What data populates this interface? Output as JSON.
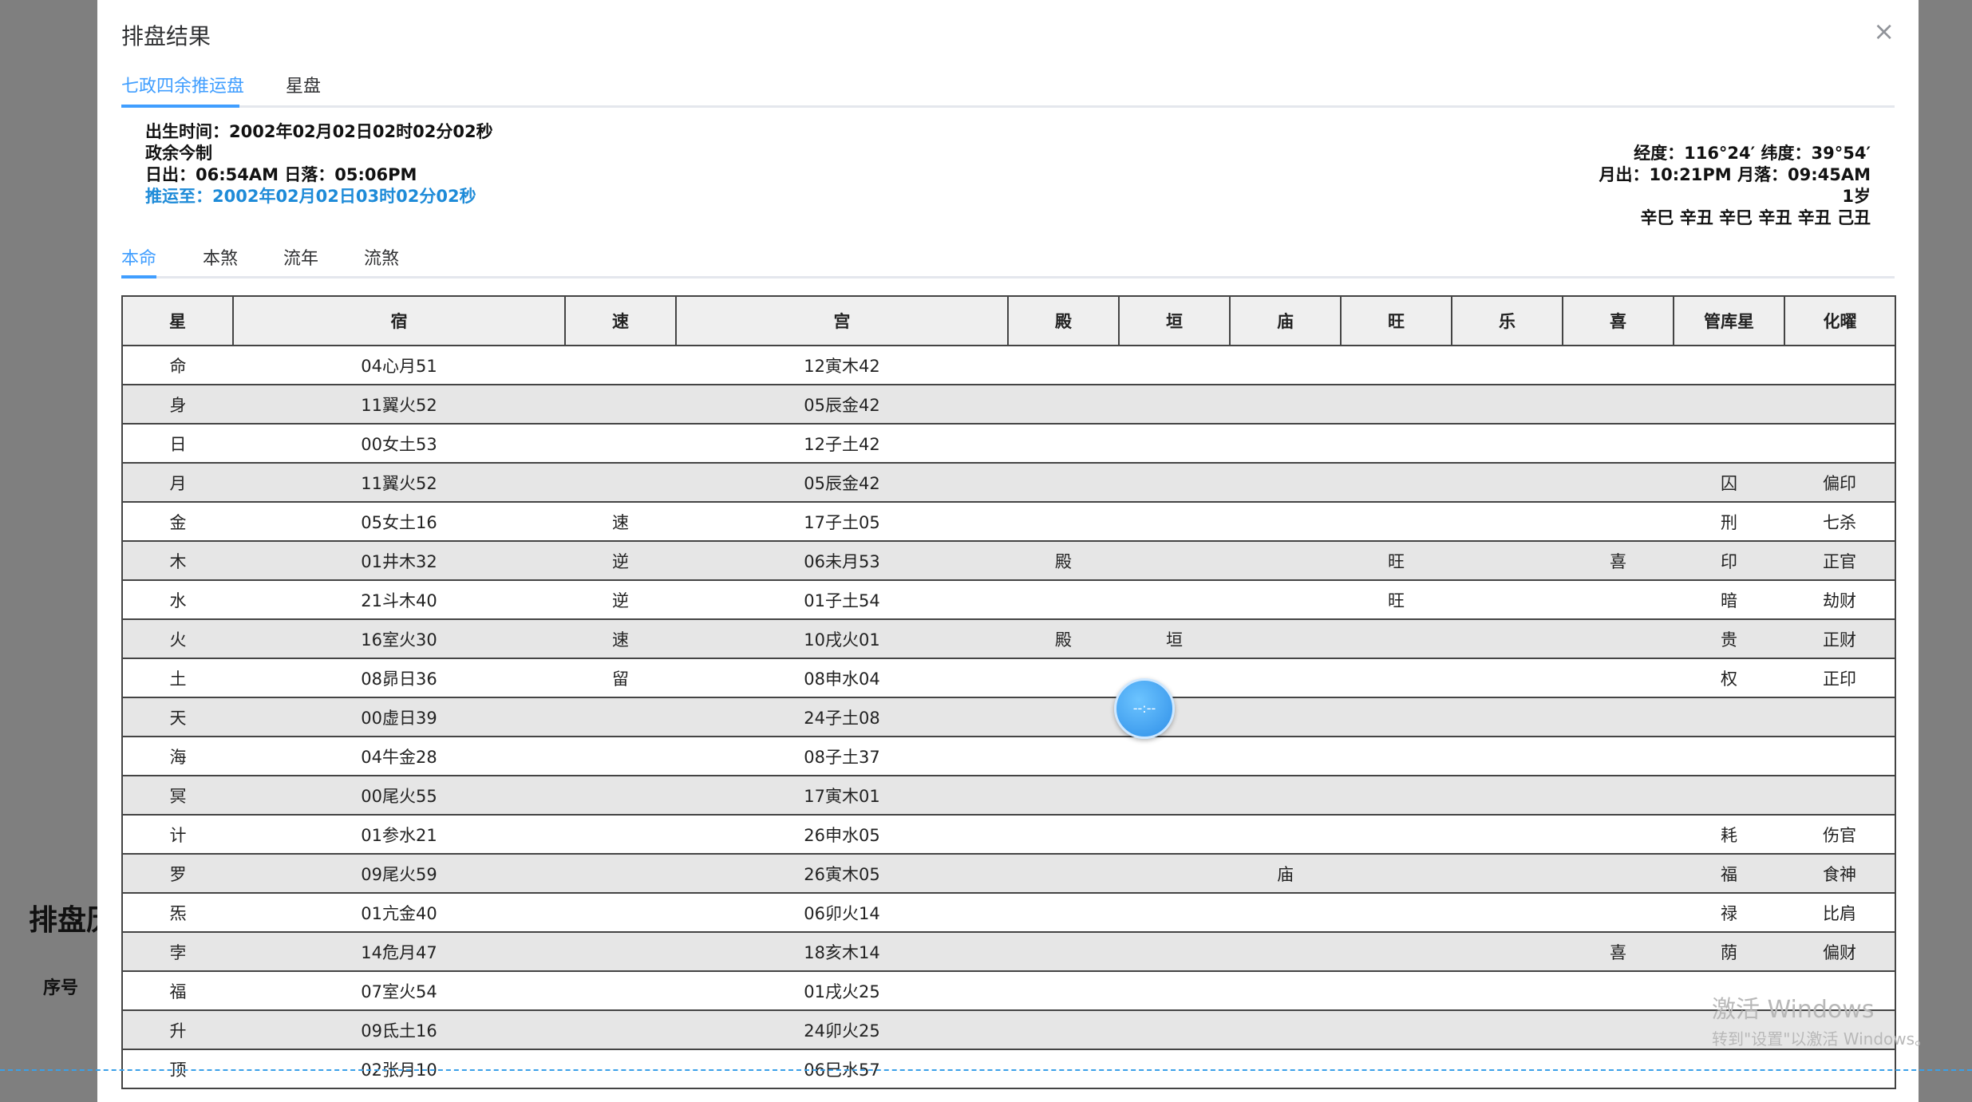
{
  "background": {
    "title": "排盘历",
    "column": "序号"
  },
  "modal": {
    "title": "排盘结果",
    "close": "×",
    "tabs": [
      {
        "label": "七政四余推运盘",
        "active": true
      },
      {
        "label": "星盘",
        "active": false
      }
    ],
    "info_left": {
      "birth": "出生时间：2002年02月02日02时02分02秒",
      "system": "政余今制",
      "sun": "日出：06:54AM 日落：05:06PM",
      "progress": "推运至：2002年02月02日03时02分02秒"
    },
    "info_right": {
      "coords": "经度：116°24′ 纬度：39°54′",
      "moon": "月出：10:21PM 月落：09:45AM",
      "age": "1岁",
      "ganzhi": "辛巳 辛丑 辛巳 辛丑 辛丑 己丑"
    },
    "subtabs": [
      {
        "label": "本命",
        "active": true
      },
      {
        "label": "本煞",
        "active": false
      },
      {
        "label": "流年",
        "active": false
      },
      {
        "label": "流煞",
        "active": false
      }
    ],
    "table": {
      "headers": [
        "星",
        "宿",
        "速",
        "宫",
        "殿",
        "垣",
        "庙",
        "旺",
        "乐",
        "喜",
        "管库星",
        "化曜"
      ],
      "rows": [
        [
          "命",
          "04心月51",
          "",
          "12寅木42",
          "",
          "",
          "",
          "",
          "",
          "",
          "",
          ""
        ],
        [
          "身",
          "11翼火52",
          "",
          "05辰金42",
          "",
          "",
          "",
          "",
          "",
          "",
          "",
          ""
        ],
        [
          "日",
          "00女土53",
          "",
          "12子土42",
          "",
          "",
          "",
          "",
          "",
          "",
          "",
          ""
        ],
        [
          "月",
          "11翼火52",
          "",
          "05辰金42",
          "",
          "",
          "",
          "",
          "",
          "",
          "囚",
          "偏印"
        ],
        [
          "金",
          "05女土16",
          "速",
          "17子土05",
          "",
          "",
          "",
          "",
          "",
          "",
          "刑",
          "七杀"
        ],
        [
          "木",
          "01井木32",
          "逆",
          "06未月53",
          "殿",
          "",
          "",
          "旺",
          "",
          "喜",
          "印",
          "正官"
        ],
        [
          "水",
          "21斗木40",
          "逆",
          "01子土54",
          "",
          "",
          "",
          "旺",
          "",
          "",
          "暗",
          "劫财"
        ],
        [
          "火",
          "16室火30",
          "速",
          "10戌火01",
          "殿",
          "垣",
          "",
          "",
          "",
          "",
          "贵",
          "正财"
        ],
        [
          "土",
          "08昴日36",
          "留",
          "08申水04",
          "",
          "",
          "",
          "",
          "",
          "",
          "权",
          "正印"
        ],
        [
          "天",
          "00虚日39",
          "",
          "24子土08",
          "",
          "",
          "",
          "",
          "",
          "",
          "",
          ""
        ],
        [
          "海",
          "04牛金28",
          "",
          "08子土37",
          "",
          "",
          "",
          "",
          "",
          "",
          "",
          ""
        ],
        [
          "冥",
          "00尾火55",
          "",
          "17寅木01",
          "",
          "",
          "",
          "",
          "",
          "",
          "",
          ""
        ],
        [
          "计",
          "01参水21",
          "",
          "26申水05",
          "",
          "",
          "",
          "",
          "",
          "",
          "耗",
          "伤官"
        ],
        [
          "罗",
          "09尾火59",
          "",
          "26寅木05",
          "",
          "",
          "庙",
          "",
          "",
          "",
          "福",
          "食神"
        ],
        [
          "炁",
          "01亢金40",
          "",
          "06卯火14",
          "",
          "",
          "",
          "",
          "",
          "",
          "禄",
          "比肩"
        ],
        [
          "孛",
          "14危月47",
          "",
          "18亥木14",
          "",
          "",
          "",
          "",
          "",
          "喜",
          "荫",
          "偏财"
        ],
        [
          "福",
          "07室火54",
          "",
          "01戌火25",
          "",
          "",
          "",
          "",
          "",
          "",
          "",
          ""
        ],
        [
          "升",
          "09氐土16",
          "",
          "24卯火25",
          "",
          "",
          "",
          "",
          "",
          "",
          "",
          ""
        ],
        [
          "顶",
          "02张月10",
          "",
          "06巳水57",
          "",
          "",
          "",
          "",
          "",
          "",
          "",
          ""
        ]
      ]
    }
  },
  "float_button": "--:--",
  "watermark": {
    "line1": "激活 Windows",
    "line2": "转到\"设置\"以激活 Windows。"
  }
}
